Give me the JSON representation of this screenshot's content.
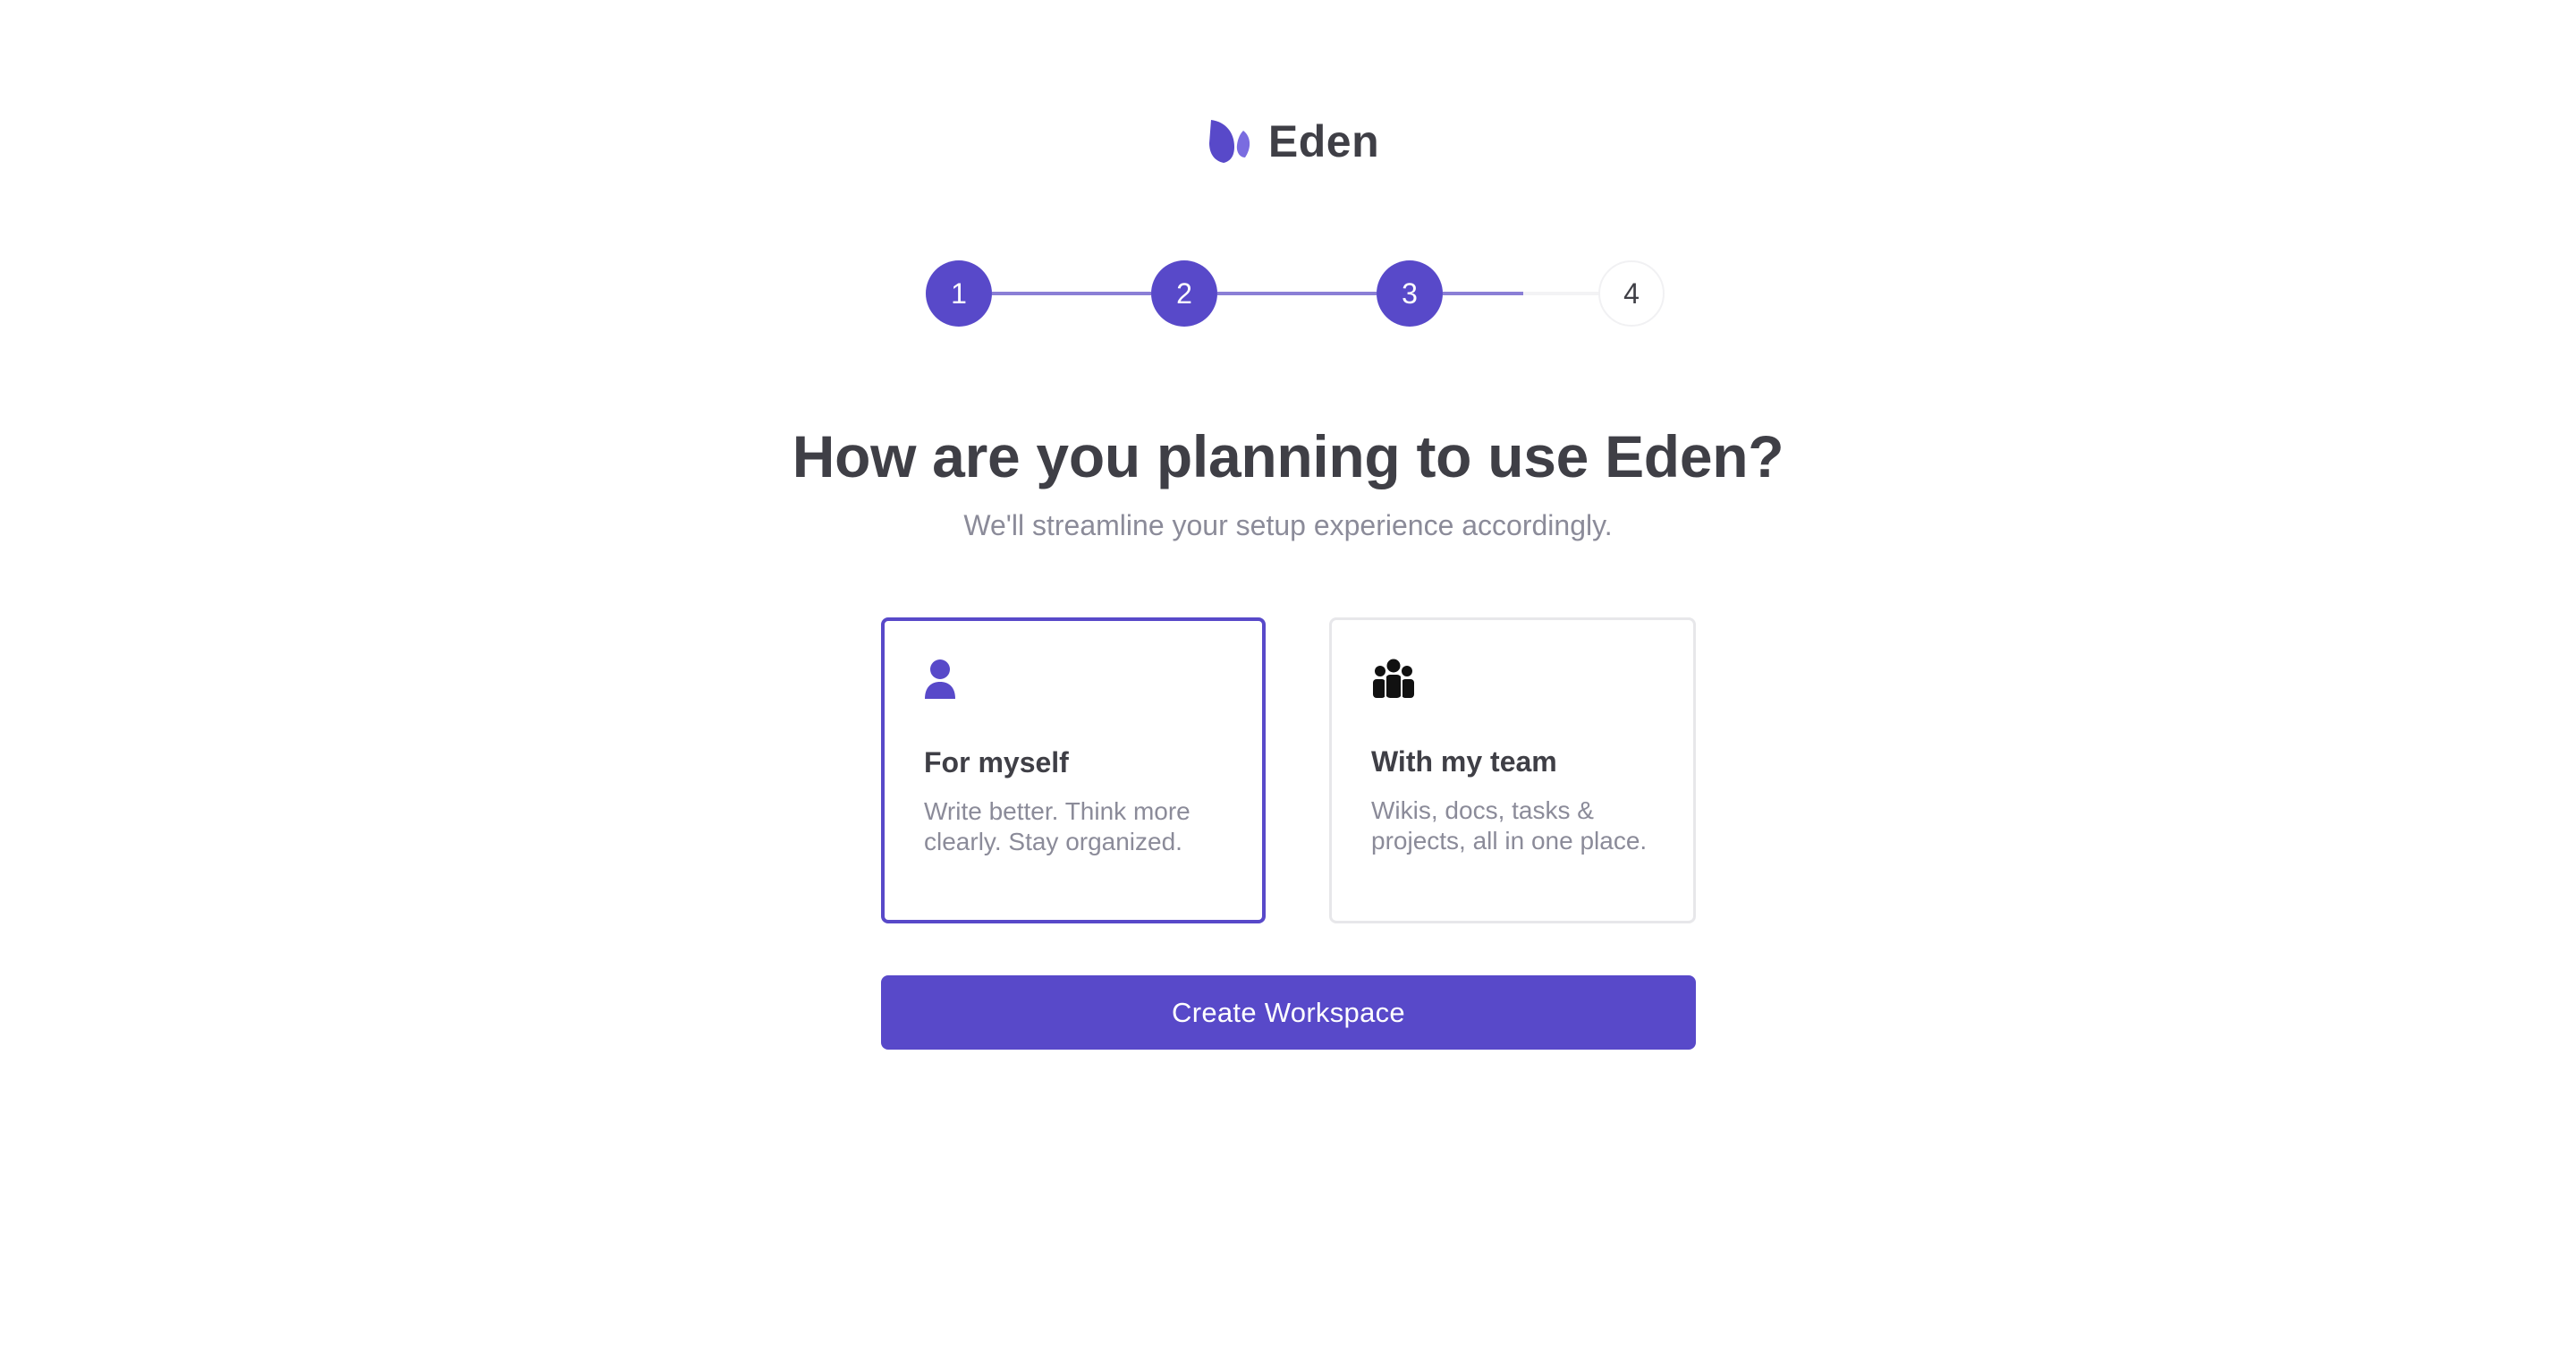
{
  "brand": {
    "name": "Eden",
    "icon": "leaf-logo-icon",
    "accent_color": "#5849c9"
  },
  "stepper": {
    "steps": [
      {
        "label": "1",
        "state": "complete"
      },
      {
        "label": "2",
        "state": "complete"
      },
      {
        "label": "3",
        "state": "current"
      },
      {
        "label": "4",
        "state": "upcoming"
      }
    ]
  },
  "heading": {
    "title": "How are you planning to use Eden?",
    "subtitle": "We'll streamline your setup experience accordingly."
  },
  "options": [
    {
      "icon": "user-icon",
      "title": "For myself",
      "description": "Write better. Think more clearly. Stay organized.",
      "selected": true
    },
    {
      "icon": "team-icon",
      "title": "With my team",
      "description": "Wikis, docs, tasks & projects, all in one place.",
      "selected": false
    }
  ],
  "actions": {
    "create_label": "Create Workspace"
  }
}
